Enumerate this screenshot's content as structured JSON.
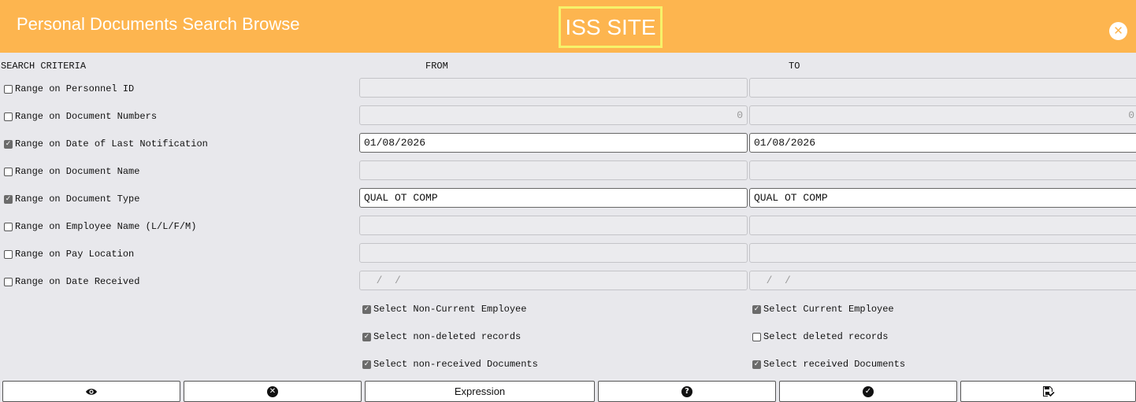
{
  "header": {
    "title": "Personal Documents Search Browse",
    "site": "ISS SITE",
    "close_icon": "circle-x-icon"
  },
  "columns": {
    "criteria": "SEARCH CRITERIA",
    "from": "FROM",
    "to": "TO"
  },
  "rows": [
    {
      "label": "Range on Personnel ID",
      "checked": false,
      "from": "",
      "to": ""
    },
    {
      "label": "Range on Document Numbers",
      "checked": false,
      "from": "0",
      "to": "0"
    },
    {
      "label": "Range on Date of Last Notification",
      "checked": true,
      "from": "01/08/2026",
      "to": "01/08/2026"
    },
    {
      "label": "Range on Document Name",
      "checked": false,
      "from": "",
      "to": ""
    },
    {
      "label": "Range on Document Type",
      "checked": true,
      "from": "QUAL OT COMP",
      "to": "QUAL OT COMP"
    },
    {
      "label": "Range on Employee Name (L/L/F/M)",
      "checked": false,
      "from": "",
      "to": ""
    },
    {
      "label": "Range on Pay Location",
      "checked": false,
      "from": "",
      "to": ""
    },
    {
      "label": "Range on Date Received",
      "checked": false,
      "from": "  /  /",
      "to": "  /  /"
    }
  ],
  "options": {
    "non_current": {
      "label": "Select Non-Current Employee",
      "checked": true
    },
    "current": {
      "label": "Select Current Employee",
      "checked": true
    },
    "non_deleted": {
      "label": "Select non-deleted records",
      "checked": true
    },
    "deleted": {
      "label": "Select deleted records",
      "checked": false
    },
    "non_received": {
      "label": "Select non-received Documents",
      "checked": true
    },
    "received": {
      "label": "Select received Documents",
      "checked": true
    }
  },
  "buttons": {
    "view_icon": "eye-icon",
    "cancel_icon": "circle-x-icon",
    "expression_label": "Expression",
    "help_icon": "question-circle-icon",
    "ok_icon": "check-circle-icon",
    "save_icon": "save-check-icon"
  }
}
